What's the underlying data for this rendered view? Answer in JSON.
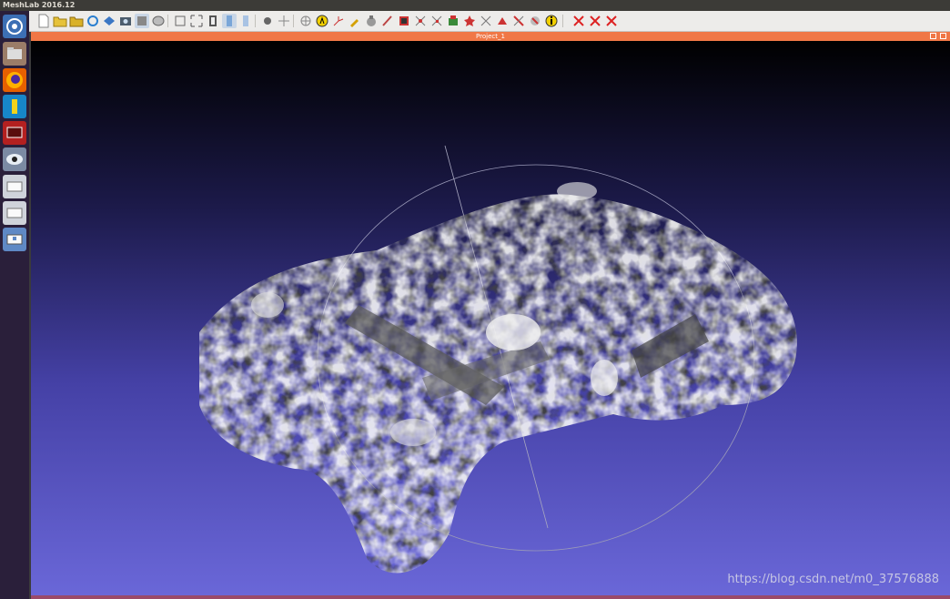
{
  "app": {
    "title": "MeshLab 2016.12"
  },
  "document": {
    "title": "Project_1"
  },
  "launcher": {
    "items": [
      {
        "name": "ubuntu-dash-icon",
        "color": "#3c6fb4"
      },
      {
        "name": "files-icon",
        "color": "#9b7d68"
      },
      {
        "name": "firefox-icon",
        "color": "#e66000"
      },
      {
        "name": "app-blue-icon",
        "color": "#1786c9"
      },
      {
        "name": "monitor-red-icon",
        "color": "#b32020"
      },
      {
        "name": "meshlab-eye-icon",
        "color": "#7b8aa3"
      },
      {
        "name": "drive-icon",
        "color": "#cfd3da"
      },
      {
        "name": "drive-icon",
        "color": "#cfd3da"
      },
      {
        "name": "drive-usb-icon",
        "color": "#5f89c5"
      }
    ]
  },
  "toolbar": {
    "icons": [
      "new-icon",
      "open-icon",
      "open-project-icon",
      "reload-icon",
      "save-icon",
      "snapshot-icon",
      "points-render-icon",
      "wireframe-render-icon",
      "bounding-box-icon",
      "fullscreen-icon",
      "layer-icon",
      "view-icon",
      "stereo-icon",
      "light-icon",
      "move-icon",
      "align-icon",
      "annotate-icon",
      "measure-icon",
      "paint-icon",
      "color-icon",
      "select-faces-icon",
      "select-vertices-icon",
      "select-connected-icon",
      "delete-icon",
      "selection-icon",
      "pick-icon",
      "z-paint-icon",
      "info-icon",
      "delete-faces-icon",
      "delete-vertices-icon",
      "delete-selection-icon"
    ]
  },
  "colors": {
    "accent": "#f07746",
    "viewport_top": "#000000",
    "viewport_bottom": "#6a67d8"
  },
  "watermark": "https://blog.csdn.net/m0_37576888"
}
